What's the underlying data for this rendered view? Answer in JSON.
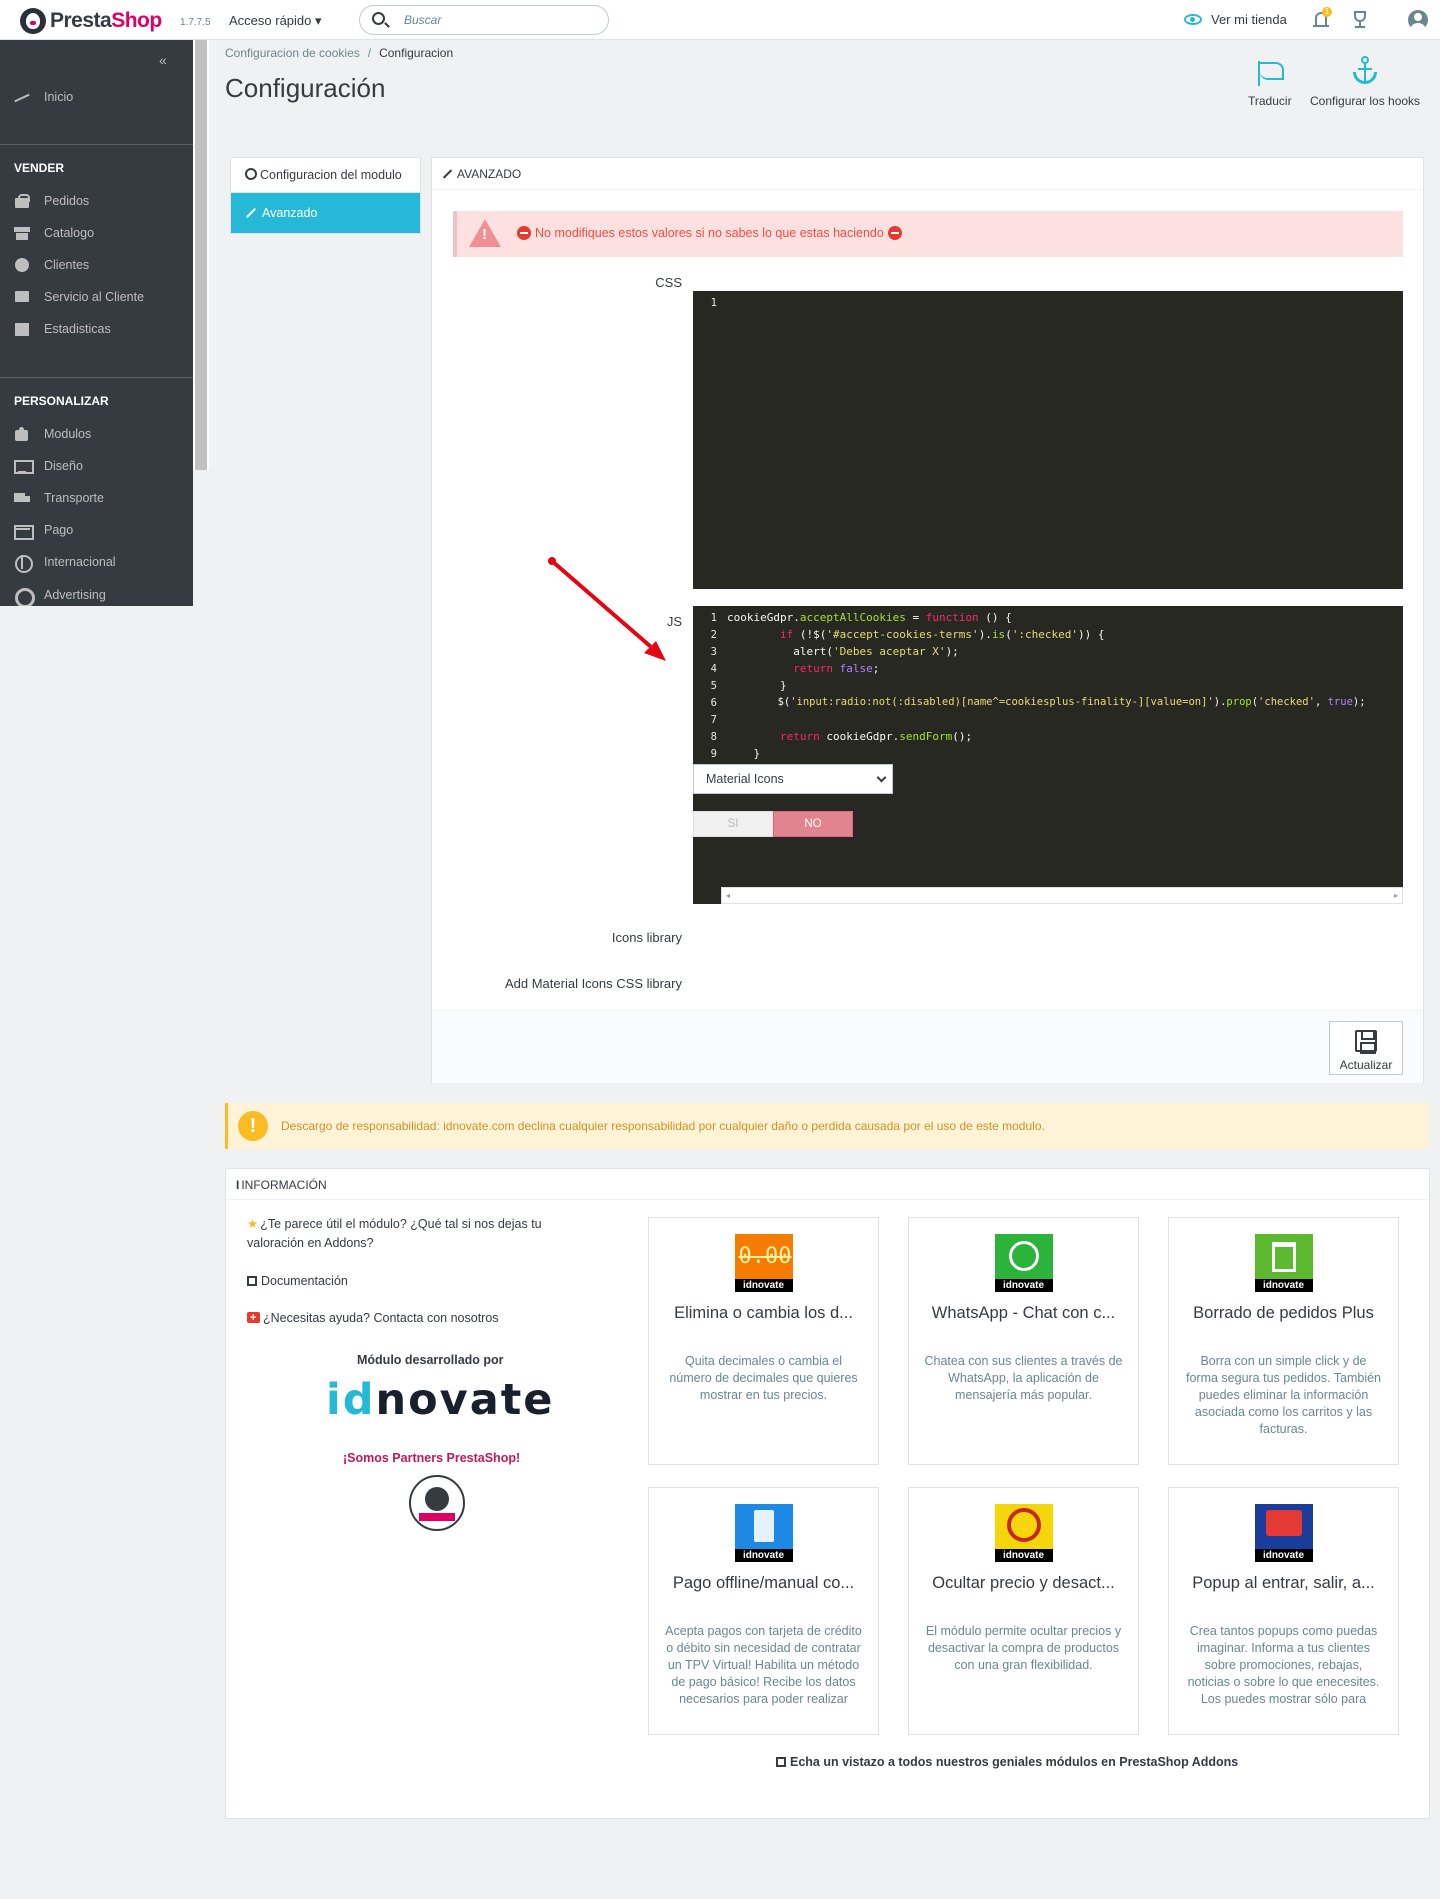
{
  "header": {
    "logo_text_a": "Presta",
    "logo_text_b": "Shop",
    "version": "1.7.7.5",
    "quick_access": "Acceso rápido ▾",
    "search_placeholder": "Buscar",
    "view_store": "Ver mi tienda",
    "notification_count": "1"
  },
  "sidebar": {
    "collapse": "«",
    "dashboard": "Inicio",
    "section_sell": "VENDER",
    "sell_items": [
      "Pedidos",
      "Catalogo",
      "Clientes",
      "Servicio al Cliente",
      "Estadisticas"
    ],
    "section_customize": "PERSONALIZAR",
    "customize_items": [
      "Modulos",
      "Diseño",
      "Transporte",
      "Pago",
      "Internacional",
      "Advertising"
    ]
  },
  "page": {
    "breadcrumb_parent": "Configuracion de cookies",
    "breadcrumb_current": "Configuracion",
    "title": "Configuración",
    "toolbar": {
      "translate": "Traducir",
      "hooks": "Configurar los hooks"
    }
  },
  "tabs": [
    "Configuracion del modulo",
    "Avanzado"
  ],
  "panel": {
    "heading": "AVANZADO",
    "danger_message": "No modifiques estos valores si no sabes lo que estas haciendo",
    "css_label": "CSS",
    "css_gutter": "1",
    "js_label": "JS",
    "js_gutter": [
      "1",
      "2",
      "3",
      "4",
      "5",
      "6",
      "7",
      "8",
      "9"
    ],
    "icons_library_label": "Icons library",
    "icons_library_value": "Material Icons",
    "material_css_label": "Add Material Icons CSS library",
    "switch_yes": "SI",
    "switch_no": "NO",
    "save_label": "Actualizar"
  },
  "js_code": {
    "l1a": "cookieGdpr.",
    "l1b": "acceptAllCookies",
    "l1c": " = ",
    "l1d": "function",
    "l1e": " () {",
    "l2a": "        ",
    "l2b": "if",
    "l2c": " (!$(",
    "l2d": "'#accept-cookies-terms'",
    "l2e": ").",
    "l2f": "is",
    "l2g": "(",
    "l2h": "':checked'",
    "l2i": ")) {",
    "l3a": "          alert(",
    "l3b": "'Debes aceptar X'",
    "l3c": ");",
    "l4a": "          ",
    "l4b": "return",
    "l4c": " ",
    "l4d": "false",
    "l4e": ";",
    "l5": "        }",
    "l6a": "        $(",
    "l6b": "'input:radio:not(:disabled)[name^=cookiesplus-finality-][value=on]'",
    "l6c": ").",
    "l6d": "prop",
    "l6e": "(",
    "l6f": "'checked'",
    "l6g": ", ",
    "l6h": "true",
    "l6i": ");",
    "l8a": "        ",
    "l8b": "return",
    "l8c": " cookieGdpr.",
    "l8d": "sendForm",
    "l8e": "();",
    "l9": "    }"
  },
  "disclaimer": "Descargo de responsabilidad: idnovate.com declina cualquier responsabilidad por cualquier daño o perdida causada por el uso de este modulo.",
  "info": {
    "heading": "INFORMACIÓN",
    "rate_line1": "¿Te parece útil el módulo? ¿Qué tal si nos dejas tu",
    "rate_line2": "valoración en Addons?",
    "docs": "Documentación",
    "help": "¿Necesitas ayuda? Contacta con nosotros",
    "developed_by": "Módulo desarrollado por",
    "brand_id": "id",
    "brand_rest": "novate",
    "partners": "¡Somos Partners PrestaShop!",
    "see_all": "Echa un vistazo a todos nuestros geniales módulos en PrestaShop Addons",
    "brand_small": "idnovate",
    "decimals_mark": "0.00"
  },
  "cards": [
    {
      "title": "Elimina o cambia los d...",
      "desc": "Quita decimales o cambia el número de decimales que quieres mostrar en tus precios.",
      "icon": "decimals-icon",
      "color": "#f57c00"
    },
    {
      "title": "WhatsApp - Chat con c...",
      "desc": "Chatea con sus clientes a través de WhatsApp, la aplicación de mensajería más popular.",
      "icon": "whatsapp-icon",
      "color": "#2bb33a"
    },
    {
      "title": "Borrado de pedidos Plus",
      "desc": "Borra con un simple click y de forma segura tus pedidos. También puedes eliminar la información asociada como los carritos y las facturas.",
      "icon": "trash-icon",
      "color": "#5cb82e"
    },
    {
      "title": "Pago offline/manual co...",
      "desc": "Acepta pagos con tarjeta de crédito o débito sin necesidad de contratar un TPV Virtual! Habilita un método de pago básico! Recibe los datos necesarios para poder realizar",
      "icon": "pos-terminal-icon",
      "color": "#1e88e5"
    },
    {
      "title": "Ocultar precio y desact...",
      "desc": "El módulo permite ocultar precios y desactivar la compra de productos con una gran flexibilidad.",
      "icon": "hide-price-icon",
      "color": "#f4d60b"
    },
    {
      "title": "Popup al entrar, salir, a...",
      "desc": "Crea tantos popups como puedas imaginar. Informa a tus clientes sobre promociones, rebajas, noticias o sobre lo que enecesites. Los puedes mostrar sólo para",
      "icon": "popup-icon",
      "color": "#1a3c9a"
    }
  ],
  "colors": {
    "accent": "#25b9d7",
    "brand": "#df0067",
    "sidebar": "#363a41",
    "danger": "#f54c3e",
    "warning": "#fbbb22",
    "arrow": "#e30613"
  }
}
